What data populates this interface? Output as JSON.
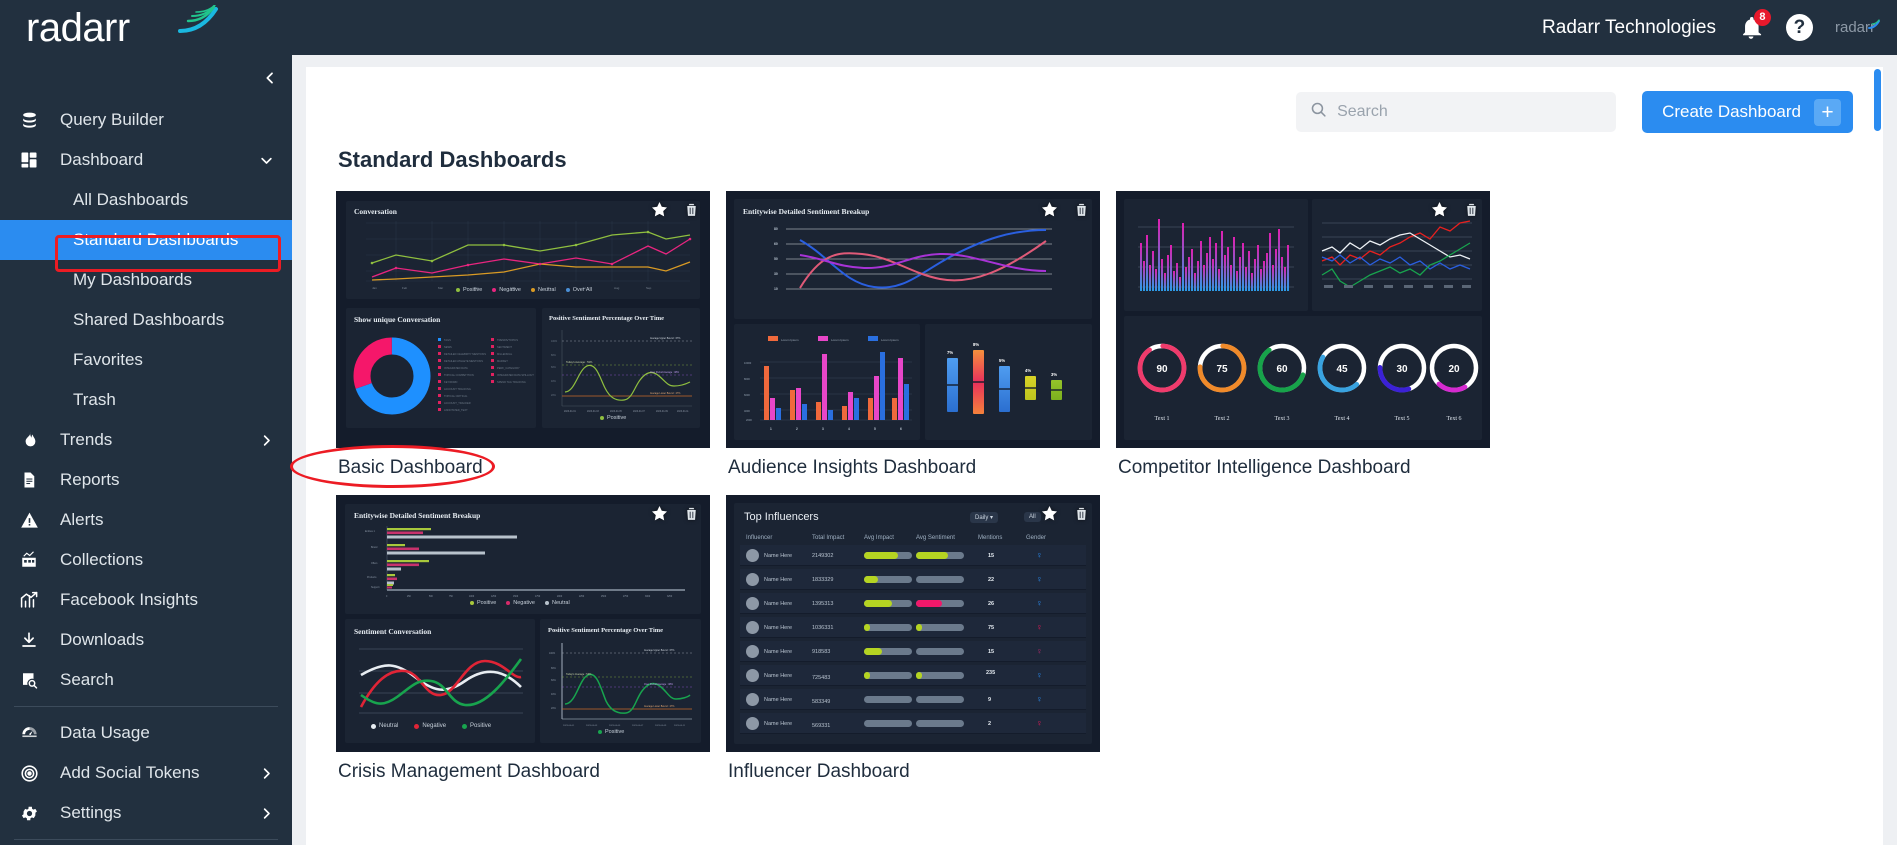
{
  "brand": {
    "name": "radarr",
    "wave_icon": "signal-wave-icon"
  },
  "topbar": {
    "org_name": "Radarr Technologies",
    "bell_icon": "bell-icon",
    "notification_count": "8",
    "help_icon": "help-circle-icon",
    "mini_logo": "radarr"
  },
  "sidebar": {
    "collapse_icon": "chevron-left-icon",
    "items": [
      {
        "label": "Query Builder",
        "icon": "database-icon",
        "chevron": "",
        "active": false
      },
      {
        "label": "Dashboard",
        "icon": "grid-icon",
        "chevron": "chevron-down-icon",
        "active": false
      }
    ],
    "sub_items": [
      {
        "label": "All Dashboards",
        "active": false
      },
      {
        "label": "Standard Dashboards",
        "active": true
      },
      {
        "label": "My Dashboards",
        "active": false
      },
      {
        "label": "Shared Dashboards",
        "active": false
      },
      {
        "label": "Favorites",
        "active": false
      },
      {
        "label": "Trash",
        "active": false
      }
    ],
    "items2": [
      {
        "label": "Trends",
        "icon": "flame-icon",
        "chevron": "chevron-right-icon"
      },
      {
        "label": "Reports",
        "icon": "document-icon",
        "chevron": ""
      },
      {
        "label": "Alerts",
        "icon": "warning-triangle-icon",
        "chevron": ""
      },
      {
        "label": "Collections",
        "icon": "collections-icon",
        "chevron": ""
      },
      {
        "label": "Facebook Insights",
        "icon": "chart-up-icon",
        "chevron": ""
      },
      {
        "label": "Downloads",
        "icon": "download-icon",
        "chevron": ""
      },
      {
        "label": "Search",
        "icon": "search-doc-icon",
        "chevron": ""
      }
    ],
    "items3": [
      {
        "label": "Data Usage",
        "icon": "gauge-icon",
        "chevron": ""
      },
      {
        "label": "Add Social Tokens",
        "icon": "target-icon",
        "chevron": "chevron-right-icon"
      },
      {
        "label": "Settings",
        "icon": "gear-icon",
        "chevron": "chevron-right-icon"
      }
    ]
  },
  "toolbar": {
    "search_placeholder": "Search",
    "search_value": "",
    "search_icon": "search-icon",
    "create_label": "Create Dashboard",
    "plus_icon": "plus-icon"
  },
  "page": {
    "title": "Standard Dashboards"
  },
  "annotations": {
    "highlight_nav": "Standard Dashboards",
    "highlight_card": "Basic Dashboard",
    "color": "#ec1c24"
  },
  "cards": [
    {
      "label": "Basic Dashboard",
      "star_icon": "star-icon",
      "trash_icon": "trash-icon"
    },
    {
      "label": "Audience Insights Dashboard",
      "star_icon": "star-icon",
      "trash_icon": "trash-icon"
    },
    {
      "label": "Competitor Intelligence Dashboard",
      "star_icon": "star-icon",
      "trash_icon": "trash-icon"
    },
    {
      "label": "Crisis Management Dashboard",
      "star_icon": "star-icon",
      "trash_icon": "trash-icon"
    },
    {
      "label": "Influencer Dashboard",
      "star_icon": "star-icon",
      "trash_icon": "trash-icon"
    }
  ],
  "thumb1": {
    "chart1_title": "Conversation",
    "chart1_legend": [
      {
        "label": "Positive",
        "color": "#8fbf3f"
      },
      {
        "label": "Negative",
        "color": "#e8257f"
      },
      {
        "label": "Neutral",
        "color": "#d99a24"
      },
      {
        "label": "Over All",
        "color": "#4a8fd6"
      }
    ],
    "chart2_title": "Show unique Conversation",
    "chart3_title": "Positive Sentiment Percentage Over Time",
    "chart3_legend": [
      {
        "label": "Positive",
        "color": "#8fbf3f"
      }
    ]
  },
  "thumb2": {
    "chart1_title": "Entitywise Detailed Sentiment Breakup",
    "yticks": [
      "80",
      "60",
      "50",
      "30",
      "10"
    ],
    "bar_xticks": [
      "1",
      "2",
      "3",
      "4",
      "5",
      "6"
    ],
    "pct_values": [
      "7%",
      "8%",
      "5%",
      "4%",
      "3%"
    ]
  },
  "thumb3": {
    "gauges": [
      {
        "value": "90",
        "label": "Text 1",
        "color": "#ef3b6c"
      },
      {
        "value": "75",
        "label": "Text 2",
        "color": "#f08a2a"
      },
      {
        "value": "60",
        "label": "Text 3",
        "color": "#17a34a"
      },
      {
        "value": "45",
        "label": "Text 4",
        "color": "#39a3e0"
      },
      {
        "value": "30",
        "label": "Text 5",
        "color": "#3b21d6"
      },
      {
        "value": "20",
        "label": "Text 6",
        "color": "#d62ad0"
      }
    ]
  },
  "thumb4": {
    "chart1_title": "Entitywise Detailed Sentiment Breakup",
    "chart1_legend": [
      {
        "label": "Positive",
        "color": "#8fbf3f"
      },
      {
        "label": "Negative",
        "color": "#d62a6a"
      },
      {
        "label": "Neutral",
        "color": "#b8c2cc"
      }
    ],
    "chart2_title": "Sentiment Conversation",
    "chart2_legend": [
      {
        "label": "Neutral",
        "color": "#e8edf2"
      },
      {
        "label": "Negative",
        "color": "#e02436"
      },
      {
        "label": "Positive",
        "color": "#18a44e"
      }
    ],
    "chart3_title": "Positive Sentiment Percentage Over Time",
    "chart3_legend": [
      {
        "label": "Positive",
        "color": "#18a44e"
      }
    ]
  },
  "thumb5": {
    "title": "Top Influencers",
    "period_label": "Daily",
    "period_icon": "caret-down-icon",
    "filter_label": "All",
    "columns": [
      "Influencer",
      "Total Impact",
      "Avg Impact",
      "Avg Sentiment",
      "Mentions",
      "Gender"
    ],
    "rows": [
      {
        "name": "Name Here",
        "total": "2149302",
        "impact": 72,
        "impact_color": "#b5d422",
        "sentiment": 68,
        "sentiment_color": "#b5d422",
        "mentions": "15",
        "gender": "female",
        "gender_color": "#2b8cf0"
      },
      {
        "name": "Name Here",
        "total": "1833329",
        "impact": 28,
        "impact_color": "#b5d422",
        "sentiment": 0,
        "sentiment_color": "#6b7a8c",
        "mentions": "22",
        "gender": "female",
        "gender_color": "#2b8cf0"
      },
      {
        "name": "Name Here",
        "total": "1395313",
        "impact": 58,
        "impact_color": "#b5d422",
        "sentiment": 55,
        "sentiment_color": "#f0186a",
        "mentions": "26",
        "gender": "female",
        "gender_color": "#2b8cf0"
      },
      {
        "name": "Name Here",
        "total": "1036331",
        "impact": 10,
        "impact_color": "#b5d422",
        "sentiment": 10,
        "sentiment_color": "#b5d422",
        "mentions": "75",
        "gender": "female",
        "gender_color": "#e8195a"
      },
      {
        "name": "Name Here",
        "total": "918583",
        "impact": 35,
        "impact_color": "#b5d422",
        "sentiment": 0,
        "sentiment_color": "#6b7a8c",
        "mentions": "15",
        "gender": "female",
        "gender_color": "#b02a6a"
      },
      {
        "name": "Name Here",
        "total": "725483",
        "impact": 10,
        "impact_color": "#b5d422",
        "sentiment": 10,
        "sentiment_color": "#b5d422",
        "mentions": "235",
        "gender": "female",
        "gender_color": "#2b8cf0"
      },
      {
        "name": "Name Here",
        "total": "583349",
        "impact": 0,
        "impact_color": "#6b7a8c",
        "sentiment": 0,
        "sentiment_color": "#6b7a8c",
        "mentions": "9",
        "gender": "female",
        "gender_color": "#2b8cf0"
      },
      {
        "name": "Name Here",
        "total": "569331",
        "impact": 0,
        "impact_color": "#6b7a8c",
        "sentiment": 0,
        "sentiment_color": "#6b7a8c",
        "mentions": "2",
        "gender": "female",
        "gender_color": "#e8195a"
      }
    ]
  }
}
